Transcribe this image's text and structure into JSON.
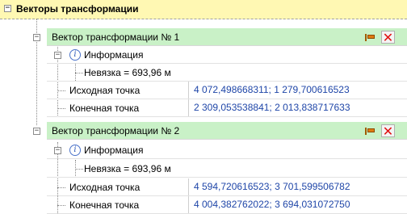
{
  "root": {
    "label": "Векторы трансформации",
    "toggle": "−"
  },
  "vectors": [
    {
      "header": "Вектор трансформации № 1",
      "info_label": "Информация",
      "residual": "Невязка = 693,96 м",
      "source_label": "Исходная точка",
      "source_value": "4 072,498668311; 1 279,700616523",
      "target_label": "Конечная точка",
      "target_value": "2 309,053538841; 2 013,838717633"
    },
    {
      "header": "Вектор трансформации № 2",
      "info_label": "Информация",
      "residual": "Невязка = 693,96 м",
      "source_label": "Исходная точка",
      "source_value": "4 594,720616523; 3 701,599506782",
      "target_label": "Конечная точка",
      "target_value": "4 004,382762022; 3 694,031072750"
    }
  ],
  "icons": {
    "info": "info-icon",
    "flag": "flag-icon",
    "delete": "delete-icon",
    "toggle": "minus-box-icon"
  },
  "colors": {
    "root_bg": "#fff8b3",
    "header_bg": "#c9f1c7",
    "value_text": "#1f46a8",
    "delete": "#e01010"
  }
}
